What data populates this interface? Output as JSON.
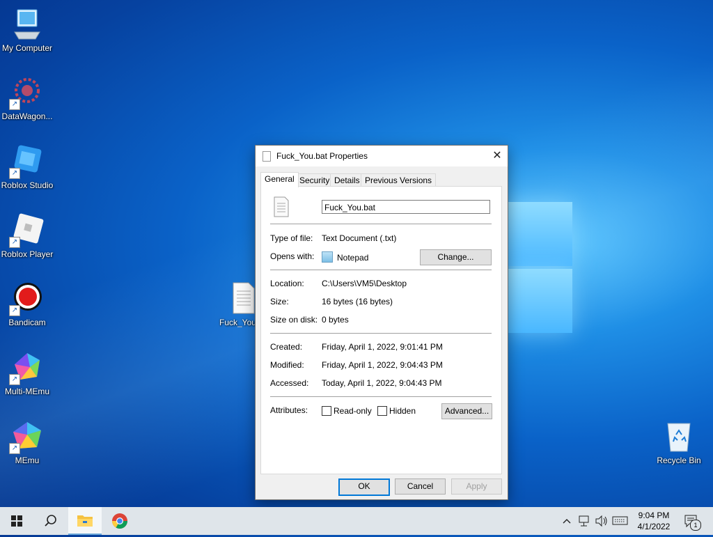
{
  "desktop": {
    "icons": [
      {
        "label": "My Computer",
        "icon": "computer-icon",
        "shortcut": false
      },
      {
        "label": "DataWagon...",
        "icon": "datawagon-icon",
        "shortcut": true
      },
      {
        "label": "Roblox Studio",
        "icon": "roblox-studio-icon",
        "shortcut": true
      },
      {
        "label": "Roblox Player",
        "icon": "roblox-player-icon",
        "shortcut": true
      },
      {
        "label": "Bandicam",
        "icon": "bandicam-icon",
        "shortcut": true
      },
      {
        "label": "Multi-MEmu",
        "icon": "multi-memu-icon",
        "shortcut": true
      },
      {
        "label": "MEmu",
        "icon": "memu-icon",
        "shortcut": true
      }
    ],
    "file_icon_label": "Fuck_You",
    "recycle_bin_label": "Recycle Bin"
  },
  "dialog": {
    "title": "Fuck_You.bat Properties",
    "tabs": [
      "General",
      "Security",
      "Details",
      "Previous Versions"
    ],
    "filename": "Fuck_You.bat",
    "type_label": "Type of file:",
    "type_value": "Text Document (.txt)",
    "opens_label": "Opens with:",
    "opens_value": "Notepad",
    "change_button": "Change...",
    "location_label": "Location:",
    "location_value": "C:\\Users\\VM5\\Desktop",
    "size_label": "Size:",
    "size_value": "16 bytes (16 bytes)",
    "size_disk_label": "Size on disk:",
    "size_disk_value": "0 bytes",
    "created_label": "Created:",
    "created_value": "Friday, April 1, 2022, 9:01:41 PM",
    "modified_label": "Modified:",
    "modified_value": "Friday, April 1, 2022, 9:04:43 PM",
    "accessed_label": "Accessed:",
    "accessed_value": "Today, April 1, 2022, 9:04:43 PM",
    "attributes_label": "Attributes:",
    "readonly_label": "Read-only",
    "hidden_label": "Hidden",
    "advanced_button": "Advanced...",
    "ok_button": "OK",
    "cancel_button": "Cancel",
    "apply_button": "Apply"
  },
  "taskbar": {
    "time": "9:04 PM",
    "date": "4/1/2022",
    "notification_count": "1",
    "accent": "#0078d7"
  }
}
